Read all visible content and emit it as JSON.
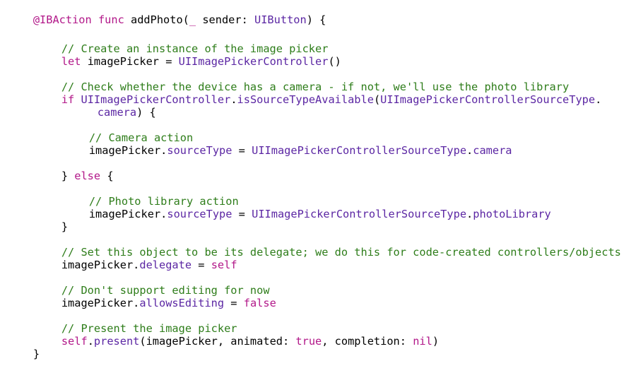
{
  "editor": {
    "line01": {
      "attr": "@IBAction",
      "sp1": " ",
      "kw": "func",
      "name": " addPhoto(",
      "kw2": "_",
      "rest": " sender: ",
      "type": "UIButton",
      "end": ") {"
    },
    "line02": {
      "comment": "// Create an instance of the image picker"
    },
    "line03": {
      "kw": "let",
      "mid": " imagePicker = ",
      "type": "UIImagePickerController",
      "end": "()"
    },
    "line04": {
      "comment": "// Check whether the device has a camera - if not, we'll use the photo library"
    },
    "line05": {
      "kw": "if",
      "sp": " ",
      "type": "UIImagePickerController",
      "dot": ".",
      "method": "isSourceTypeAvailable",
      "paren": "(",
      "type2": "UIImagePickerControllerSourceType",
      "end": "."
    },
    "line06": {
      "prop": "camera",
      "end": ") {"
    },
    "line07": {
      "comment": "// Camera action"
    },
    "line08": {
      "obj": "imagePicker.",
      "prop": "sourceType",
      "eq": " = ",
      "type": "UIImagePickerControllerSourceType",
      "dot": ".",
      "value": "camera"
    },
    "line09": {
      "brace": "} ",
      "kw": "else",
      "end": " {"
    },
    "line10": {
      "comment": "// Photo library action"
    },
    "line11": {
      "obj": "imagePicker.",
      "prop": "sourceType",
      "eq": " = ",
      "type": "UIImagePickerControllerSourceType",
      "dot": ".",
      "value": "photoLibrary"
    },
    "line12": {
      "brace": "}"
    },
    "line13": {
      "comment": "// Set this object to be its delegate; we do this for code-created controllers/objects"
    },
    "line14": {
      "obj": "imagePicker.",
      "prop": "delegate",
      "eq": " = ",
      "kw": "self"
    },
    "line15": {
      "comment": "// Don't support editing for now"
    },
    "line16": {
      "obj": "imagePicker.",
      "prop": "allowsEditing",
      "eq": " = ",
      "kw": "false"
    },
    "line17": {
      "comment": "// Present the image picker"
    },
    "line18": {
      "kw": "self",
      "dot": ".",
      "method": "present",
      "a": "(imagePicker, animated: ",
      "kw2": "true",
      "b": ", completion: ",
      "kw3": "nil",
      "end": ")"
    },
    "line19": {
      "brace": "}"
    }
  },
  "colors": {
    "keyword": "#b21889",
    "type": "#5b26a3",
    "comment": "#2e7d1a",
    "text": "#000000",
    "background": "#ffffff"
  }
}
